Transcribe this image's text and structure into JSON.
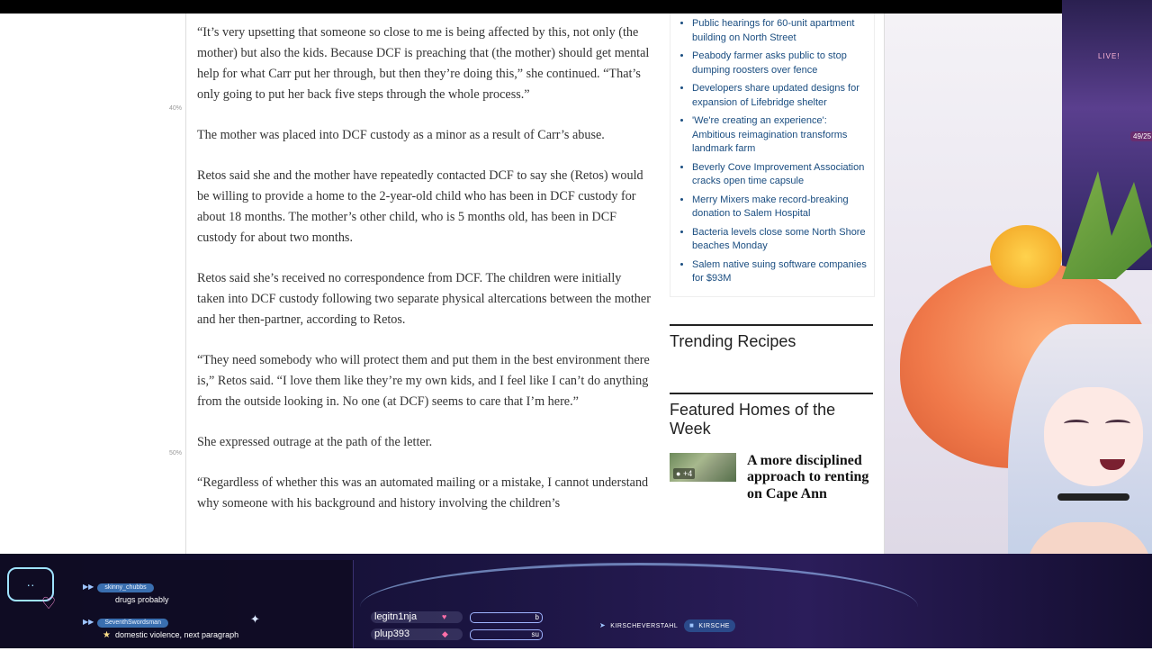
{
  "article": {
    "paragraphs": [
      "“It’s very upsetting that someone so close to me is being affected by this, not only (the mother) but also the kids. Because DCF is preaching that (the mother) should get mental help for what Carr put her through, but then they’re doing this,” she continued. “That’s only going to put her back five steps through the whole process.”",
      "The mother was placed into DCF custody as a minor as a result of Carr’s abuse.",
      "Retos said she and the mother have repeatedly contacted DCF to say she (Retos) would be willing to provide a home to the 2-year-old child who has been in DCF custody for about 18 months. The mother’s other child, who is 5 months old, has been in DCF custody for about two months.",
      "Retos said she’s received no correspondence from DCF. The children were initially taken into DCF custody following two separate physical altercations between the mother and her then-partner, according to Retos.",
      "“They need somebody who will protect them and put them in the best environment there is,” Retos said. “I love them like they’re my own kids, and I feel like I can’t do anything from the outside looking in. No one (at DCF) seems to care that I’m here.”",
      "She expressed outrage at the path of the letter.",
      "“Regardless of whether this was an automated mailing or a mistake, I cannot understand why someone with his background and history involving the children’s"
    ]
  },
  "gutter": {
    "percent_40": "40%",
    "percent_50": "50%"
  },
  "sidebar": {
    "headlines": [
      "Public hearings for 60-unit apartment building on North Street",
      "Peabody farmer asks public to stop dumping roosters over fence",
      "Developers share updated designs for expansion of Lifebridge shelter",
      "'We're creating an experience': Ambitious reimagination transforms landmark farm",
      "Beverly Cove Improvement Association cracks open time capsule",
      "Merry Mixers make record-breaking donation to Salem Hospital",
      "Bacteria levels close some North Shore beaches Monday",
      "Salem native suing software companies for $93M"
    ],
    "trending_title": "Trending Recipes",
    "featured_title": "Featured Homes of the Week",
    "featured_card": {
      "photo_count": "+4",
      "title": "A more disciplined approach to renting on Cape Ann"
    }
  },
  "stream": {
    "live_label": "LIVE!",
    "counter": "49/25",
    "chat": [
      {
        "user": "skinny_chubbs",
        "text": "drugs probably"
      },
      {
        "user": "SeventhSwordsman",
        "text": "domestic violence, next paragraph"
      }
    ],
    "names": [
      {
        "name": "legitn1nja",
        "bar_value": "b"
      },
      {
        "name": "plup393",
        "bar_value": "su"
      }
    ],
    "socials": [
      "KIRSCHEVERSTAHL",
      "KIRSCHE"
    ]
  },
  "colors": {
    "link": "#1a4d80",
    "chat_user_bg": "#3a6fb0",
    "overlay_bg": "#1a1440"
  }
}
